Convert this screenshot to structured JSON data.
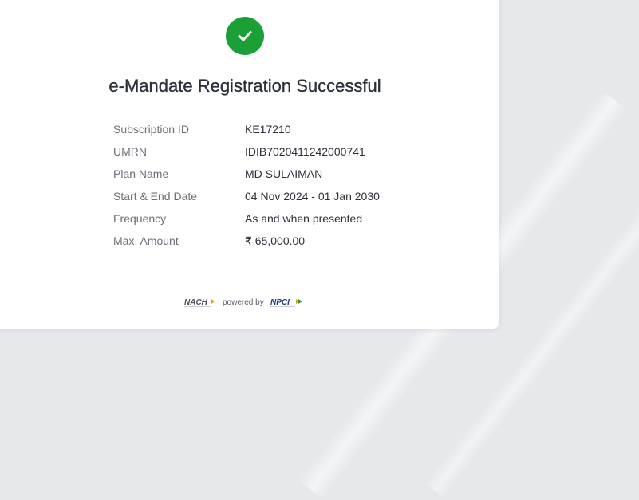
{
  "status": {
    "title": "e-Mandate Registration Successful",
    "icon": "check-icon",
    "color": "#1aa037"
  },
  "details": [
    {
      "label": "Subscription ID",
      "value": "KE17210"
    },
    {
      "label": "UMRN",
      "value": "IDIB7020411242000741"
    },
    {
      "label": "Plan Name",
      "value": "MD SULAIMAN"
    },
    {
      "label": "Start & End Date",
      "value": "04 Nov 2024 - 01 Jan 2030"
    },
    {
      "label": "Frequency",
      "value": "As and when presented"
    },
    {
      "label": "Max. Amount",
      "value": "₹ 65,000.00"
    }
  ],
  "footer": {
    "nach_logo": "NACH",
    "powered_by": "powered by",
    "npci_logo": "NPCI"
  }
}
